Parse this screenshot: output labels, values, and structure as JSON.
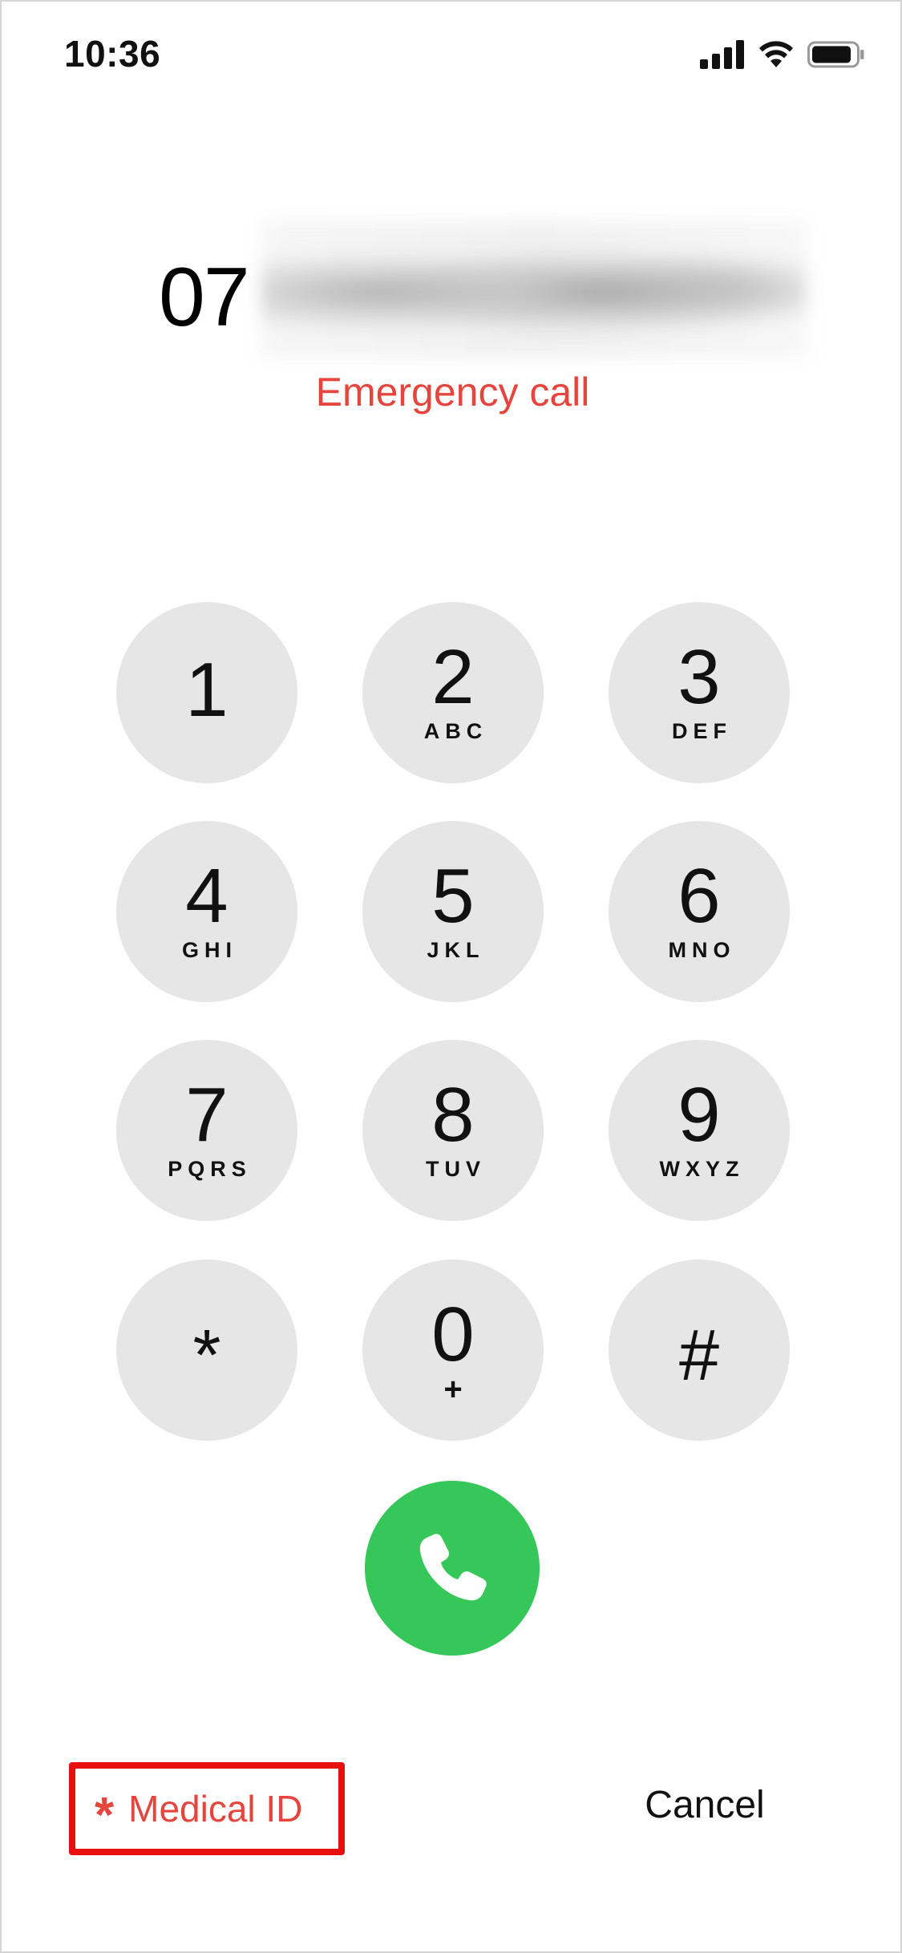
{
  "status_bar": {
    "time": "10:36",
    "icons": [
      "cellular-signal-icon",
      "wifi-icon",
      "battery-icon"
    ]
  },
  "dialer": {
    "number_visible": "07",
    "emergency_label": "Emergency call"
  },
  "keypad": {
    "keys": [
      {
        "digit": "1",
        "letters": ""
      },
      {
        "digit": "2",
        "letters": "ABC"
      },
      {
        "digit": "3",
        "letters": "DEF"
      },
      {
        "digit": "4",
        "letters": "GHI"
      },
      {
        "digit": "5",
        "letters": "JKL"
      },
      {
        "digit": "6",
        "letters": "MNO"
      },
      {
        "digit": "7",
        "letters": "PQRS"
      },
      {
        "digit": "8",
        "letters": "TUV"
      },
      {
        "digit": "9",
        "letters": "WXYZ"
      },
      {
        "digit": "*",
        "letters": ""
      },
      {
        "digit": "0",
        "letters": "+"
      },
      {
        "digit": "#",
        "letters": ""
      }
    ]
  },
  "call_button": {
    "icon": "phone-icon",
    "color": "#35c759"
  },
  "footer": {
    "medical_id_symbol": "*",
    "medical_id_label": "Medical ID",
    "cancel_label": "Cancel"
  },
  "colors": {
    "accent_red": "#e5453c",
    "key_background": "#e6e6e6",
    "highlight_box": "#e8100f"
  }
}
